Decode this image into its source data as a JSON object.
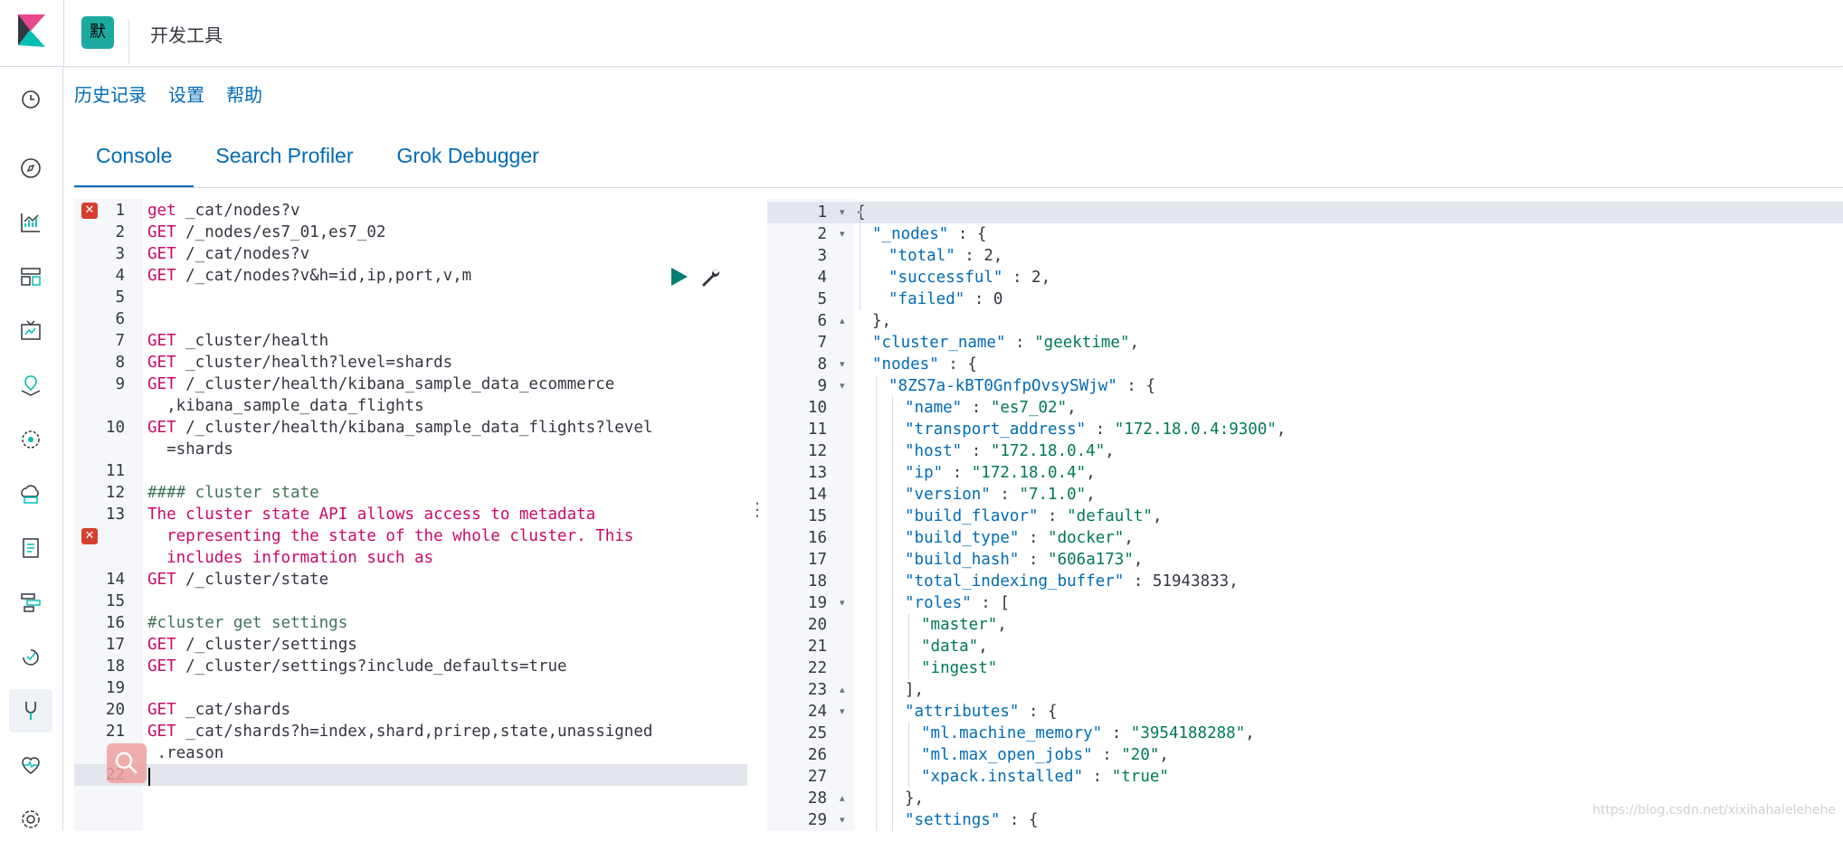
{
  "header": {
    "space_initial": "默",
    "app_title": "开发工具"
  },
  "sidenav": [
    {
      "icon": "clock-icon"
    },
    {
      "icon": "compass-icon"
    },
    {
      "icon": "visualize-icon"
    },
    {
      "icon": "dashboard-icon"
    },
    {
      "icon": "canvas-icon"
    },
    {
      "icon": "maps-icon"
    },
    {
      "icon": "ml-icon"
    },
    {
      "icon": "infra-icon"
    },
    {
      "icon": "logs-icon"
    },
    {
      "icon": "apm-icon"
    },
    {
      "icon": "uptime-icon"
    },
    {
      "icon": "devtools-icon"
    },
    {
      "icon": "monitoring-icon"
    },
    {
      "icon": "settings-icon"
    }
  ],
  "toplinks": {
    "history": "历史记录",
    "settings": "设置",
    "help": "帮助"
  },
  "tabs": {
    "console": "Console",
    "profiler": "Search Profiler",
    "grok": "Grok Debugger"
  },
  "editor": {
    "lines": [
      {
        "n": "1",
        "kw": "get",
        "text": " _cat/nodes?v"
      },
      {
        "n": "2",
        "kw": "GET",
        "text": " /_nodes/es7_01,es7_02"
      },
      {
        "n": "3",
        "kw": "GET",
        "text": " /_cat/nodes?v"
      },
      {
        "n": "4",
        "kw": "GET",
        "text": " /_cat/nodes?v&h=id,ip,port,v,m"
      },
      {
        "n": "5",
        "kw": "",
        "text": ""
      },
      {
        "n": "6",
        "kw": "",
        "text": ""
      },
      {
        "n": "7",
        "kw": "GET",
        "text": " _cluster/health"
      },
      {
        "n": "8",
        "kw": "GET",
        "text": " _cluster/health?level=shards"
      },
      {
        "n": "9",
        "kw": "GET",
        "text": " /_cluster/health/kibana_sample_data_ecommerce"
      },
      {
        "n": "",
        "kw": "",
        "text": "  ,kibana_sample_data_flights"
      },
      {
        "n": "10",
        "kw": "GET",
        "text": " /_cluster/health/kibana_sample_data_flights?level"
      },
      {
        "n": "",
        "kw": "",
        "text": "  =shards"
      },
      {
        "n": "11",
        "kw": "",
        "text": ""
      },
      {
        "n": "12",
        "kw": "",
        "text": "#### cluster state"
      },
      {
        "n": "13",
        "kw": "The",
        "text": " cluster state API allows access to metadata"
      },
      {
        "n": "",
        "kw": "",
        "text": "  representing the state of the whole cluster. This"
      },
      {
        "n": "",
        "kw": "",
        "text": "  includes information such as"
      },
      {
        "n": "14",
        "kw": "GET",
        "text": " /_cluster/state"
      },
      {
        "n": "15",
        "kw": "",
        "text": ""
      },
      {
        "n": "16",
        "kw": "",
        "text": "#cluster get settings"
      },
      {
        "n": "17",
        "kw": "GET",
        "text": " /_cluster/settings"
      },
      {
        "n": "18",
        "kw": "GET",
        "text": " /_cluster/settings?include_defaults=true"
      },
      {
        "n": "19",
        "kw": "",
        "text": ""
      },
      {
        "n": "20",
        "kw": "GET",
        "text": " _cat/shards"
      },
      {
        "n": "21",
        "kw": "GET",
        "text": " _cat/shards?h=index,shard,prirep,state,unassigned"
      },
      {
        "n": "",
        "kw": "",
        "text": " .reason"
      },
      {
        "n": "22",
        "kw": "",
        "text": ""
      }
    ]
  },
  "output": {
    "lines": [
      {
        "n": "1",
        "fold": "▾",
        "indent": 0,
        "html": "{"
      },
      {
        "n": "2",
        "fold": "▾",
        "indent": 1,
        "key": "\"_nodes\"",
        "rest": " : {"
      },
      {
        "n": "3",
        "fold": "",
        "indent": 2,
        "key": "\"total\"",
        "rest": " : 2,"
      },
      {
        "n": "4",
        "fold": "",
        "indent": 2,
        "key": "\"successful\"",
        "rest": " : 2,"
      },
      {
        "n": "5",
        "fold": "",
        "indent": 2,
        "key": "\"failed\"",
        "rest": " : 0"
      },
      {
        "n": "6",
        "fold": "▴",
        "indent": 1,
        "html": "},"
      },
      {
        "n": "7",
        "fold": "",
        "indent": 1,
        "key": "\"cluster_name\"",
        "rest": " : ",
        "str": "\"geektime\"",
        "tail": ","
      },
      {
        "n": "8",
        "fold": "▾",
        "indent": 1,
        "key": "\"nodes\"",
        "rest": " : {"
      },
      {
        "n": "9",
        "fold": "▾",
        "indent": 2,
        "key": "\"8ZS7a-kBT0GnfpOvsySWjw\"",
        "rest": " : {"
      },
      {
        "n": "10",
        "fold": "",
        "indent": 3,
        "key": "\"name\"",
        "rest": " : ",
        "str": "\"es7_02\"",
        "tail": ","
      },
      {
        "n": "11",
        "fold": "",
        "indent": 3,
        "key": "\"transport_address\"",
        "rest": " : ",
        "str": "\"172.18.0.4:9300\"",
        "tail": ","
      },
      {
        "n": "12",
        "fold": "",
        "indent": 3,
        "key": "\"host\"",
        "rest": " : ",
        "str": "\"172.18.0.4\"",
        "tail": ","
      },
      {
        "n": "13",
        "fold": "",
        "indent": 3,
        "key": "\"ip\"",
        "rest": " : ",
        "str": "\"172.18.0.4\"",
        "tail": ","
      },
      {
        "n": "14",
        "fold": "",
        "indent": 3,
        "key": "\"version\"",
        "rest": " : ",
        "str": "\"7.1.0\"",
        "tail": ","
      },
      {
        "n": "15",
        "fold": "",
        "indent": 3,
        "key": "\"build_flavor\"",
        "rest": " : ",
        "str": "\"default\"",
        "tail": ","
      },
      {
        "n": "16",
        "fold": "",
        "indent": 3,
        "key": "\"build_type\"",
        "rest": " : ",
        "str": "\"docker\"",
        "tail": ","
      },
      {
        "n": "17",
        "fold": "",
        "indent": 3,
        "key": "\"build_hash\"",
        "rest": " : ",
        "str": "\"606a173\"",
        "tail": ","
      },
      {
        "n": "18",
        "fold": "",
        "indent": 3,
        "key": "\"total_indexing_buffer\"",
        "rest": " : 51943833,"
      },
      {
        "n": "19",
        "fold": "▾",
        "indent": 3,
        "key": "\"roles\"",
        "rest": " : ["
      },
      {
        "n": "20",
        "fold": "",
        "indent": 4,
        "str": "\"master\"",
        "tail": ","
      },
      {
        "n": "21",
        "fold": "",
        "indent": 4,
        "str": "\"data\"",
        "tail": ","
      },
      {
        "n": "22",
        "fold": "",
        "indent": 4,
        "str": "\"ingest\"",
        "tail": ""
      },
      {
        "n": "23",
        "fold": "▴",
        "indent": 3,
        "html": "],"
      },
      {
        "n": "24",
        "fold": "▾",
        "indent": 3,
        "key": "\"attributes\"",
        "rest": " : {"
      },
      {
        "n": "25",
        "fold": "",
        "indent": 4,
        "key": "\"ml.machine_memory\"",
        "rest": " : ",
        "str": "\"3954188288\"",
        "tail": ","
      },
      {
        "n": "26",
        "fold": "",
        "indent": 4,
        "key": "\"ml.max_open_jobs\"",
        "rest": " : ",
        "str": "\"20\"",
        "tail": ","
      },
      {
        "n": "27",
        "fold": "",
        "indent": 4,
        "key": "\"xpack.installed\"",
        "rest": " : ",
        "str": "\"true\"",
        "tail": ""
      },
      {
        "n": "28",
        "fold": "▴",
        "indent": 3,
        "html": "},"
      },
      {
        "n": "29",
        "fold": "▾",
        "indent": 3,
        "key": "\"settings\"",
        "rest": " : {"
      }
    ]
  },
  "watermark": "https://blog.csdn.net/xixihahalelehehe"
}
